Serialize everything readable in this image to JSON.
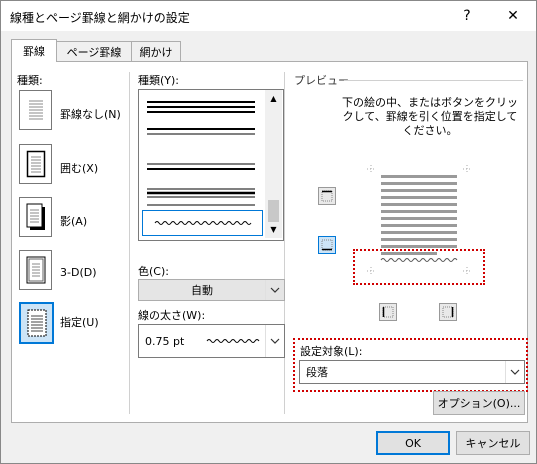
{
  "window": {
    "title": "線種とページ罫線と網かけの設定",
    "help_label": "?",
    "close_label": "✕"
  },
  "tabs": [
    {
      "label": "罫線",
      "active": true
    },
    {
      "label": "ページ罫線",
      "active": false
    },
    {
      "label": "網かけ",
      "active": false
    }
  ],
  "settings": {
    "heading": "種類:",
    "presets": [
      {
        "label": "罫線なし(N)",
        "icon": "none-border-icon"
      },
      {
        "label": "囲む(X)",
        "icon": "box-border-icon"
      },
      {
        "label": "影(A)",
        "icon": "shadow-border-icon"
      },
      {
        "label": "3-D(D)",
        "icon": "3d-border-icon"
      },
      {
        "label": "指定(U)",
        "icon": "custom-border-icon",
        "selected": true
      }
    ]
  },
  "style": {
    "heading": "種類(Y):",
    "color_label": "色(C):",
    "color_value": "自動",
    "width_label": "線の太さ(W):",
    "width_value": "0.75 pt"
  },
  "preview": {
    "heading": "プレビュー",
    "instructions": "下の絵の中、またはボタンをクリックして、罫線を引く位置を指定してください。",
    "apply_label": "設定対象(L):",
    "apply_value": "段落",
    "options_button": "オプション(O)..."
  },
  "footer": {
    "ok": "OK",
    "cancel": "キャンセル"
  },
  "colors": {
    "highlight_dotted": "#d00000",
    "selection_border": "#0078d7"
  }
}
